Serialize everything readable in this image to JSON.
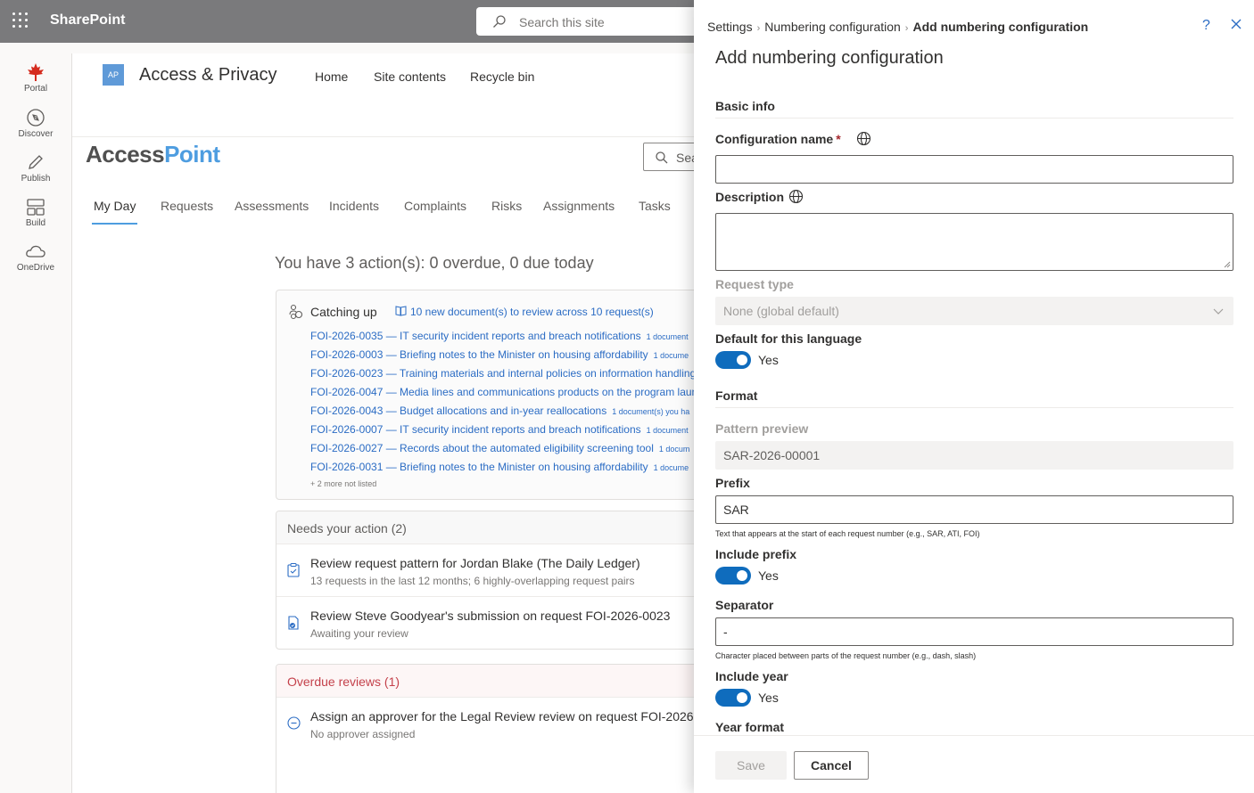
{
  "suite": {
    "app_name": "SharePoint",
    "search_placeholder": "Search this site"
  },
  "appbar": [
    {
      "label": "Portal",
      "icon": "maple-leaf-icon"
    },
    {
      "label": "Discover",
      "icon": "compass-icon"
    },
    {
      "label": "Publish",
      "icon": "pen-icon"
    },
    {
      "label": "Build",
      "icon": "layout-icon"
    },
    {
      "label": "OneDrive",
      "icon": "cloud-icon"
    }
  ],
  "site": {
    "logo_text": "AP",
    "name": "Access & Privacy",
    "nav": [
      "Home",
      "Site contents",
      "Recycle bin"
    ],
    "brand_a": "Access",
    "brand_b": "Point",
    "search_text": "Sea",
    "tabs": [
      "My Day",
      "Requests",
      "Assessments",
      "Incidents",
      "Complaints",
      "Risks",
      "Assignments",
      "Tasks"
    ],
    "summary": "You have 3 action(s): 0 overdue, 0 due today",
    "catching_up": {
      "title": "Catching up",
      "link": "10 new document(s) to review across 10 request(s)",
      "items": [
        {
          "text": "FOI-2026-0035 — IT security incident reports and breach notifications",
          "meta": "1 document"
        },
        {
          "text": "FOI-2026-0003 — Briefing notes to the Minister on housing affordability",
          "meta": "1 docume"
        },
        {
          "text": "FOI-2026-0023 — Training materials and internal policies on information handling",
          "meta": ""
        },
        {
          "text": "FOI-2026-0047 — Media lines and communications products on the program laun",
          "meta": ""
        },
        {
          "text": "FOI-2026-0043 — Budget allocations and in-year reallocations",
          "meta": "1 document(s) you ha"
        },
        {
          "text": "FOI-2026-0007 — IT security incident reports and breach notifications",
          "meta": "1 document"
        },
        {
          "text": "FOI-2026-0027 — Records about the automated eligibility screening tool",
          "meta": "1 docum"
        },
        {
          "text": "FOI-2026-0031 — Briefing notes to the Minister on housing affordability",
          "meta": "1 docume"
        }
      ],
      "more": "+ 2 more not listed"
    },
    "needs_action": {
      "title": "Needs your action (2)",
      "items": [
        {
          "title": "Review request pattern for Jordan Blake (The Daily Ledger)",
          "sub": "13 requests in the last 12 months; 6 highly-overlapping request pairs"
        },
        {
          "title": "Review Steve Goodyear's submission on request FOI-2026-0023",
          "sub": "Awaiting your review"
        }
      ]
    },
    "overdue": {
      "title": "Overdue reviews (1)",
      "items": [
        {
          "title": "Assign an approver for the Legal Review review on request FOI-2026",
          "sub": "No approver assigned"
        }
      ]
    }
  },
  "panel": {
    "breadcrumb": [
      "Settings",
      "Numbering configuration",
      "Add numbering configuration"
    ],
    "help": "?",
    "title": "Add numbering configuration",
    "basic_info": "Basic info",
    "config_name_label": "Configuration name",
    "required_mark": "*",
    "config_name_value": "",
    "description_label": "Description",
    "description_value": "",
    "request_type_label": "Request type",
    "request_type_value": "None (global default)",
    "default_lang_label": "Default for this language",
    "default_lang_toggle": "Yes",
    "format_heading": "Format",
    "pattern_preview_label": "Pattern preview",
    "pattern_preview_value": "SAR-2026-00001",
    "prefix_label": "Prefix",
    "prefix_value": "SAR",
    "prefix_hint": "Text that appears at the start of each request number (e.g., SAR, ATI, FOI)",
    "include_prefix_label": "Include prefix",
    "include_prefix_toggle": "Yes",
    "separator_label": "Separator",
    "separator_value": "-",
    "separator_hint": "Character placed between parts of the request number (e.g., dash, slash)",
    "include_year_label": "Include year",
    "include_year_toggle": "Yes",
    "year_format_label": "Year format",
    "save": "Save",
    "cancel": "Cancel"
  },
  "colors": {
    "suite": "#7a7a7c",
    "accent": "#0f6cbd",
    "link": "#2b6cc4",
    "brand": "#4e9de0",
    "overdue": "#c4414b"
  }
}
